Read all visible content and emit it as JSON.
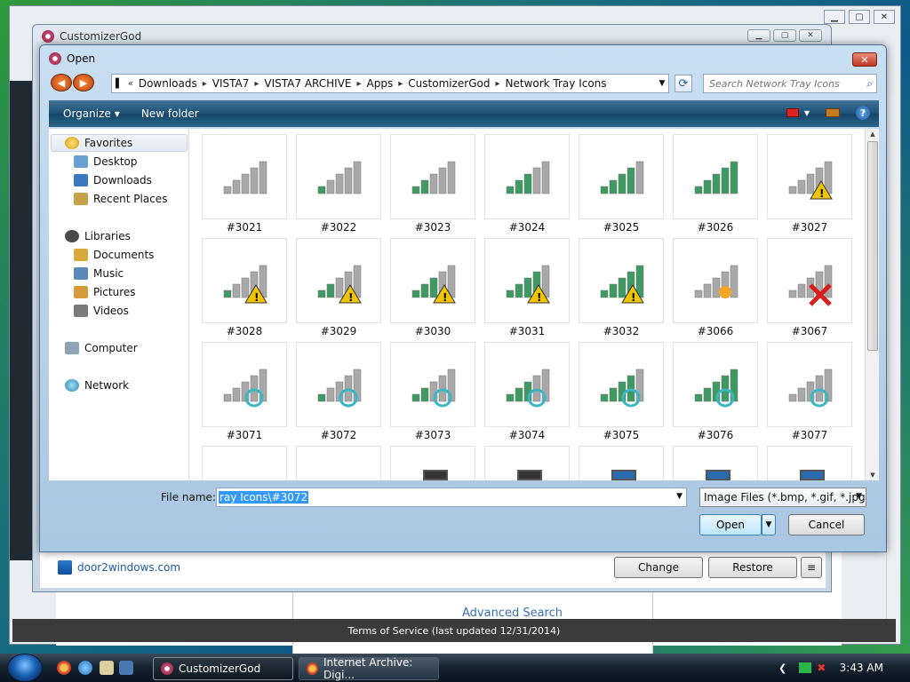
{
  "background_browser": {
    "advanced_search": "Advanced Search",
    "terms": "Terms of Service (last updated 12/31/2014)"
  },
  "customizer_window": {
    "title": "CustomizerGod",
    "footer_link": "door2windows.com",
    "change_label": "Change",
    "restore_label": "Restore",
    "menu_label": "≡"
  },
  "dialog": {
    "title": "Open",
    "address": [
      "Downloads",
      "VISTA7",
      "VISTA7 ARCHIVE",
      "Apps",
      "CustomizerGod",
      "Network Tray Icons"
    ],
    "search_placeholder": "Search Network Tray Icons",
    "toolbar": {
      "organize": "Organize",
      "new_folder": "New folder"
    },
    "nav": {
      "favorites": "Favorites",
      "desktop": "Desktop",
      "downloads": "Downloads",
      "recent_places": "Recent Places",
      "libraries": "Libraries",
      "documents": "Documents",
      "music": "Music",
      "pictures": "Pictures",
      "videos": "Videos",
      "computer": "Computer",
      "network": "Network"
    },
    "icons": [
      {
        "label": "#3021",
        "bars": 0,
        "overlay": "none"
      },
      {
        "label": "#3022",
        "bars": 1,
        "overlay": "none"
      },
      {
        "label": "#3023",
        "bars": 2,
        "overlay": "none"
      },
      {
        "label": "#3024",
        "bars": 3,
        "overlay": "none"
      },
      {
        "label": "#3025",
        "bars": 4,
        "overlay": "none"
      },
      {
        "label": "#3026",
        "bars": 5,
        "overlay": "none"
      },
      {
        "label": "#3027",
        "bars": 0,
        "overlay": "warning"
      },
      {
        "label": "#3028",
        "bars": 1,
        "overlay": "warning"
      },
      {
        "label": "#3029",
        "bars": 2,
        "overlay": "warning"
      },
      {
        "label": "#3030",
        "bars": 3,
        "overlay": "warning"
      },
      {
        "label": "#3031",
        "bars": 4,
        "overlay": "warning"
      },
      {
        "label": "#3032",
        "bars": 5,
        "overlay": "warning"
      },
      {
        "label": "#3066",
        "bars": 0,
        "overlay": "star"
      },
      {
        "label": "#3067",
        "bars": 0,
        "overlay": "error"
      },
      {
        "label": "#3071",
        "bars": 0,
        "overlay": "busy"
      },
      {
        "label": "#3072",
        "bars": 1,
        "overlay": "busy"
      },
      {
        "label": "#3073",
        "bars": 2,
        "overlay": "busy"
      },
      {
        "label": "#3074",
        "bars": 3,
        "overlay": "busy"
      },
      {
        "label": "#3075",
        "bars": 4,
        "overlay": "busy"
      },
      {
        "label": "#3076",
        "bars": 5,
        "overlay": "busy"
      },
      {
        "label": "#3077",
        "bars": 0,
        "overlay": "busy"
      }
    ],
    "file_name_label": "File name:",
    "file_name_value": "ray Icons\\#3072",
    "file_type": "Image Files (*.bmp, *.gif, *.jpg,",
    "open_label": "Open",
    "cancel_label": "Cancel"
  },
  "taskbar": {
    "tasks": [
      {
        "label": "CustomizerGod"
      },
      {
        "label": "Internet Archive: Digi..."
      }
    ],
    "clock": "3:43 AM"
  },
  "colors": {
    "bar_gray": "#a8a8a8",
    "bar_green": "#3e9a62",
    "warning": "#f2c400",
    "error": "#d81e1e",
    "busy": "#3ab6c4"
  }
}
